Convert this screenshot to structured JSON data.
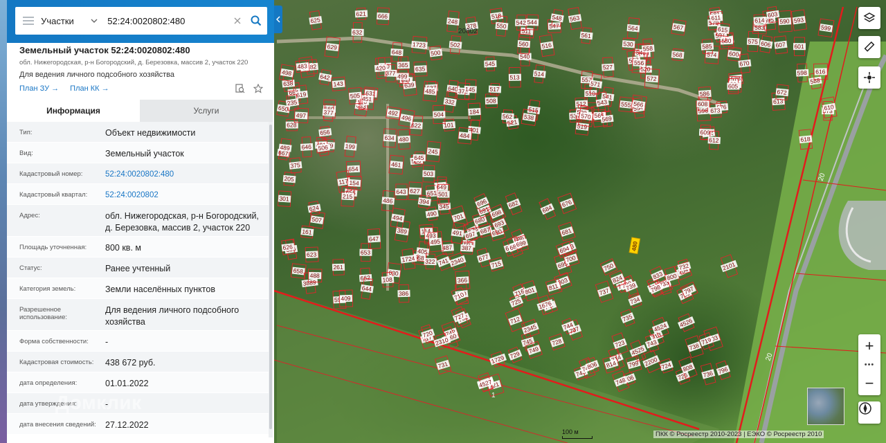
{
  "search": {
    "category": "Участки",
    "query": "52:24:0020802:480"
  },
  "parcel": {
    "title": "Земельный участок 52:24:0020802:480",
    "address_short": "обл. Нижегородская, р-н Богородский, д. Березовка, массив 2, участок 220",
    "use_short": "Для ведения личного подсобного хозяйства",
    "link_plan_zu": "План ЗУ",
    "link_plan_kk": "План КК"
  },
  "tabs": [
    {
      "label": "Информация",
      "active": true
    },
    {
      "label": "Услуги",
      "active": false
    }
  ],
  "fields": [
    {
      "key": "Тип:",
      "value": "Объект недвижимости"
    },
    {
      "key": "Вид:",
      "value": "Земельный участок"
    },
    {
      "key": "Кадастровый номер:",
      "value": "52:24:0020802:480"
    },
    {
      "key": "Кадастровый квартал:",
      "value": "52:24:0020802"
    },
    {
      "key": "Адрес:",
      "value": "обл. Нижегородская, р-н Богородский, д. Березовка, массив 2, участок 220"
    },
    {
      "key": "Площадь уточненная:",
      "value": "800 кв. м"
    },
    {
      "key": "Статус:",
      "value": "Ранее учтенный"
    },
    {
      "key": "Категория земель:",
      "value": "Земли населённых пунктов"
    },
    {
      "key": "Разрешенное использование:",
      "value": "Для ведения личного подсобного хозяйства"
    },
    {
      "key": "Форма собственности:",
      "value": "-"
    },
    {
      "key": "Кадастровая стоимость:",
      "value": "438 672 руб."
    },
    {
      "key": "дата определения:",
      "value": "01.01.2022"
    },
    {
      "key": "дата утверждения:",
      "value": "-"
    },
    {
      "key": "дата внесения сведений:",
      "value": "27.12.2022"
    }
  ],
  "watermark": "Домклик",
  "map": {
    "quarter_label": "20802",
    "road_label": "20",
    "rail_label": "1",
    "scale": "100 м",
    "copyright": "ПКК © Росреестр 2010-2023 | ЕЭКО © Росреестр 2010",
    "parcel_labels": [
      "461",
      "506",
      "594",
      "629",
      "631",
      "663",
      "664",
      "666",
      "668",
      "662",
      "667",
      "660",
      "659",
      "658",
      "656",
      "654",
      "655",
      "653",
      "651",
      "650",
      "649",
      "648",
      "647",
      "646",
      "645",
      "644",
      "643",
      "642",
      "641",
      "640",
      "639",
      "638",
      "637",
      "636",
      "635",
      "634",
      "633",
      "632",
      "630",
      "628",
      "627",
      "626",
      "625",
      "624",
      "623",
      "622",
      "621",
      "620",
      "619",
      "1724",
      "1723",
      "117",
      "375",
      "365",
      "379",
      "405",
      "394",
      "386",
      "387",
      "378",
      "376",
      "377",
      "389",
      "3889",
      "101",
      "108",
      "110",
      "114",
      "143",
      "145",
      "154",
      "161",
      "182",
      "184",
      "199",
      "205",
      "215",
      "220",
      "235",
      "245",
      "248",
      "261",
      "301",
      "322",
      "332",
      "345",
      "366",
      "377",
      "401",
      "409",
      "420",
      "451",
      "480",
      "481",
      "482",
      "483",
      "484",
      "485",
      "486",
      "487",
      "488",
      "489",
      "490",
      "491",
      "492",
      "493",
      "494",
      "495",
      "496",
      "497",
      "498",
      "499",
      "500",
      "501",
      "502",
      "503",
      "504",
      "505",
      "506",
      "507",
      "508",
      "509",
      "510",
      "511",
      "512",
      "513",
      "514",
      "515",
      "516",
      "517",
      "518",
      "519",
      "520",
      "521",
      "527",
      "529",
      "530",
      "531",
      "537",
      "538",
      "539",
      "540",
      "541",
      "542",
      "543",
      "544",
      "545",
      "546",
      "547",
      "548",
      "550",
      "552",
      "554",
      "555",
      "556",
      "557",
      "558",
      "560",
      "561",
      "562",
      "563",
      "564",
      "565",
      "566",
      "567",
      "568",
      "569",
      "570",
      "571",
      "572",
      "573",
      "574",
      "575",
      "576",
      "577",
      "578",
      "579",
      "580",
      "581",
      "583",
      "585",
      "586",
      "588",
      "590",
      "593",
      "595",
      "596",
      "597",
      "598",
      "599",
      "600",
      "601",
      "602",
      "603",
      "604",
      "605",
      "606",
      "607",
      "608",
      "609",
      "610",
      "611",
      "612",
      "613",
      "614",
      "615",
      "616",
      "618",
      "670",
      "672",
      "673",
      "674",
      "676",
      "677",
      "678",
      "680",
      "681",
      "682",
      "683",
      "684",
      "686",
      "687",
      "688",
      "690",
      "691",
      "693",
      "694",
      "695",
      "696",
      "697",
      "698",
      "699",
      "700",
      "701",
      "702",
      "703",
      "704",
      "706",
      "707",
      "708",
      "709",
      "710",
      "712",
      "713",
      "714",
      "715",
      "716",
      "717",
      "718",
      "719",
      "720",
      "721",
      "722",
      "723",
      "724",
      "725",
      "726",
      "727",
      "728",
      "729",
      "730",
      "731",
      "732",
      "733",
      "734",
      "735",
      "736",
      "737",
      "738",
      "739",
      "740",
      "741",
      "742",
      "743",
      "744",
      "745",
      "746",
      "747",
      "748",
      "749",
      "750",
      "796",
      "797",
      "798",
      "799",
      "800",
      "801",
      "803",
      "806",
      "808",
      "811",
      "814",
      "824",
      "833",
      "1676",
      "1729",
      "1878",
      "2101",
      "2160",
      "2200",
      "2310",
      "2340",
      "2345",
      "4524",
      "4525",
      "4526",
      "4527"
    ],
    "selected_label": "480"
  }
}
